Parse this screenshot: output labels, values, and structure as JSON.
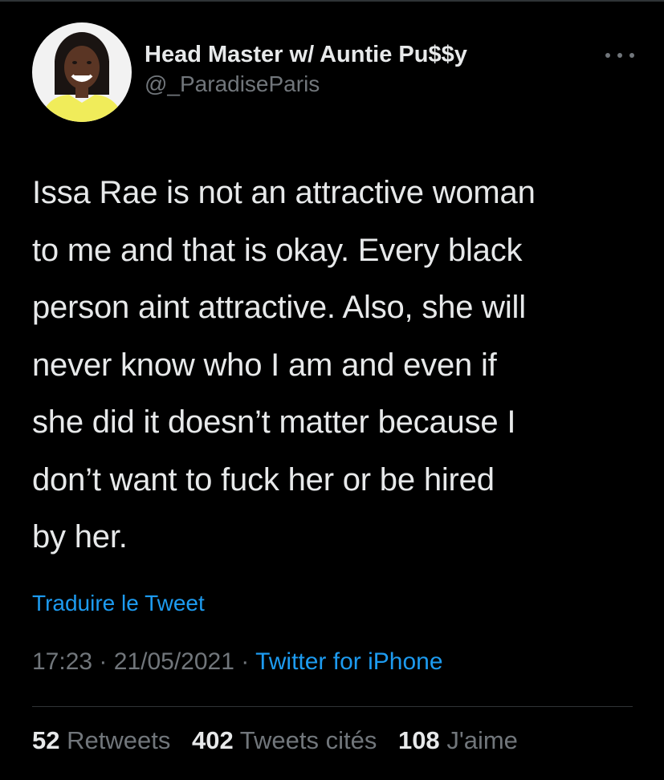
{
  "tweet": {
    "author": {
      "display_name": "Head Master w/ Auntie Pu$$y",
      "handle": "@_ParadiseParis"
    },
    "text_lines": [
      "Issa Rae is not an attractive woman",
      "to me and that is okay. Every black",
      "person aint attractive. Also, she will",
      "never know who I am and even if",
      "she did it doesn’t matter because I",
      "don’t want to fuck her or be hired",
      "by her."
    ],
    "translate_label": "Traduire le Tweet",
    "time": "17:23",
    "date": "21/05/2021",
    "separator": "·",
    "source": "Twitter for iPhone",
    "stats": {
      "retweets_count": "52",
      "retweets_label": "Retweets",
      "quotes_count": "402",
      "quotes_label": "Tweets cités",
      "likes_count": "108",
      "likes_label": "J'aime"
    }
  },
  "colors": {
    "background": "#000000",
    "text": "#e7e9ea",
    "secondary": "#71767b",
    "link": "#1d9bf0",
    "divider": "#2f3336"
  },
  "icons": {
    "more": "more-horizontal-icon"
  }
}
